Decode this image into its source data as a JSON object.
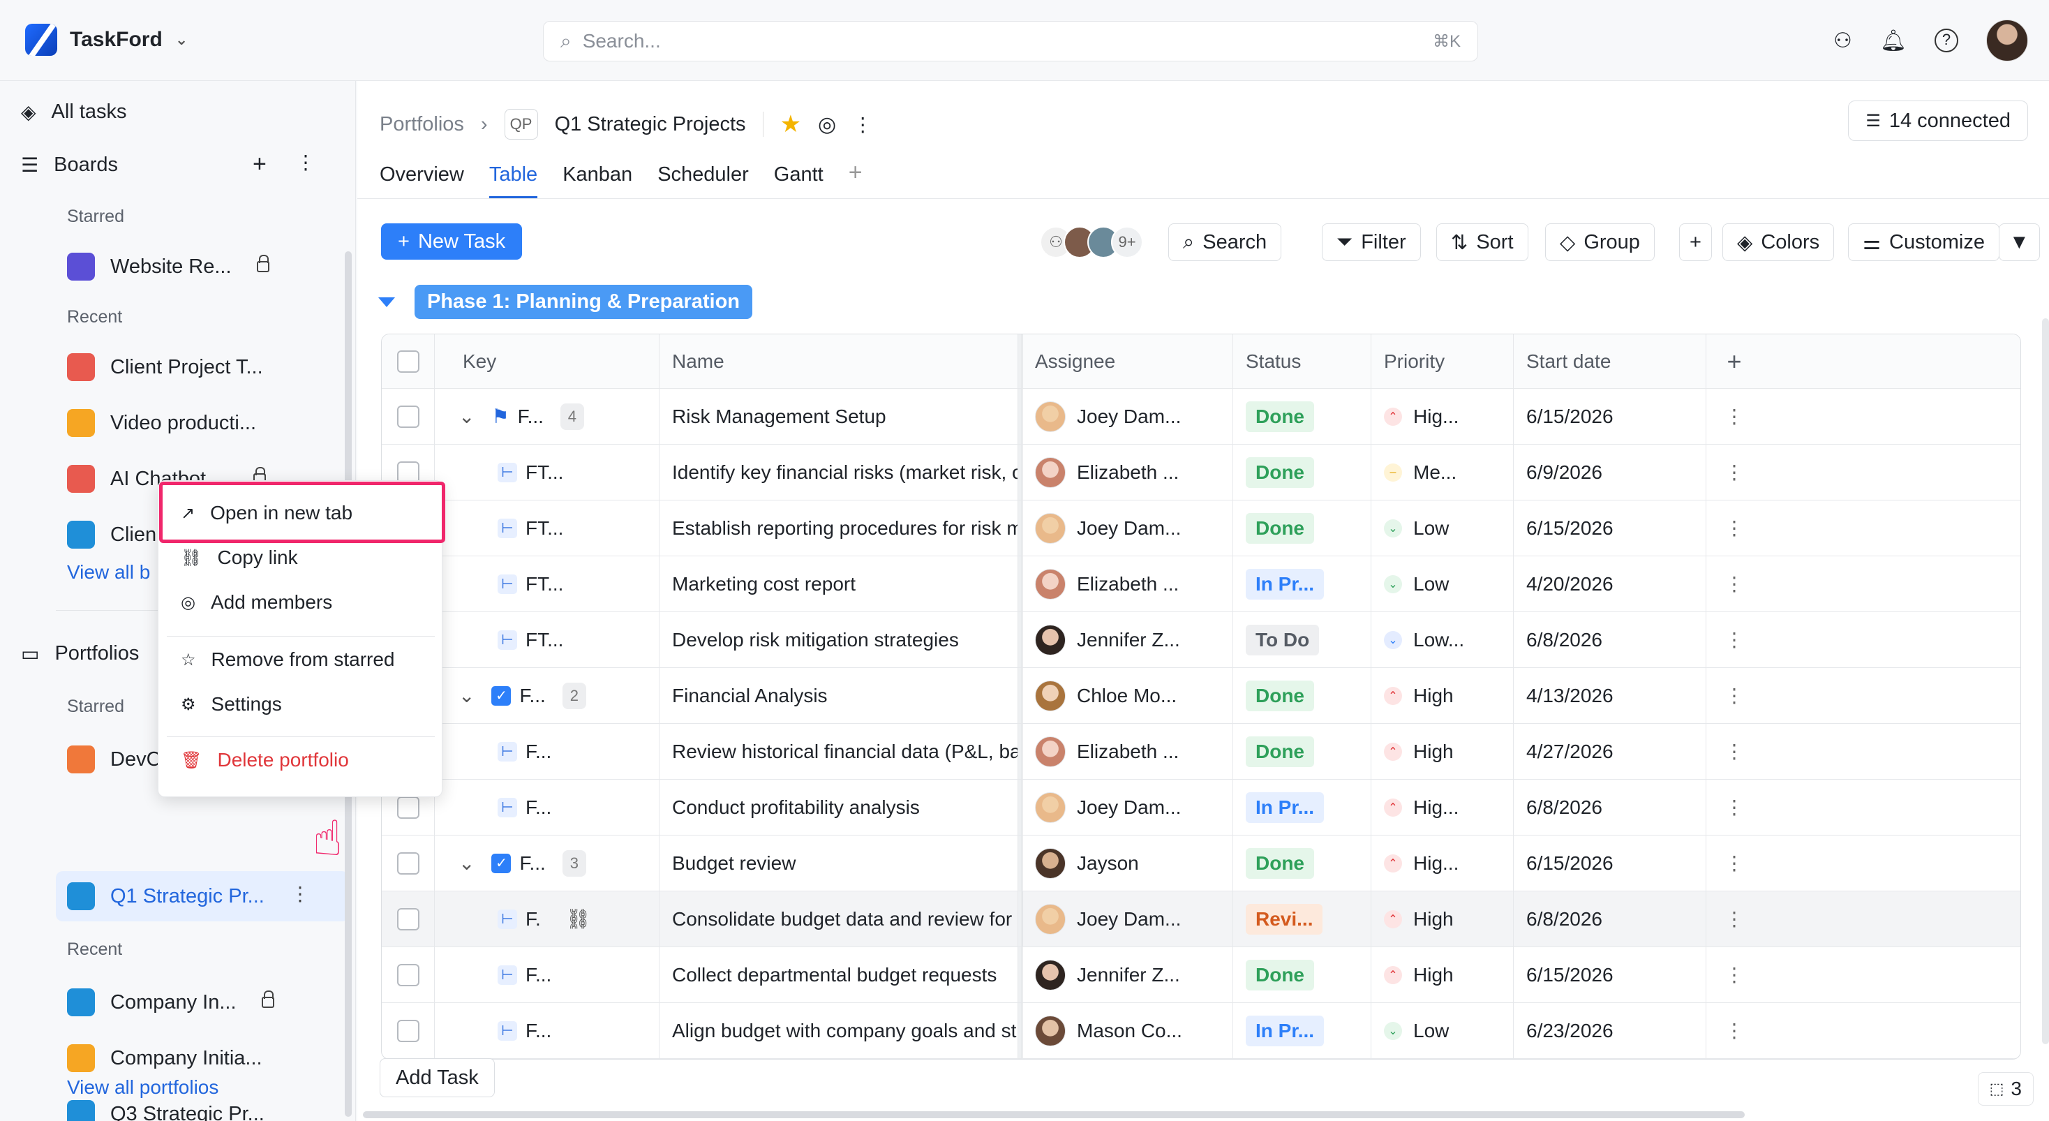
{
  "app": {
    "name": "TaskFord"
  },
  "search": {
    "placeholder": "Search...",
    "shortcut": "⌘K"
  },
  "sidebar": {
    "all_tasks": "All tasks",
    "boards": "Boards",
    "starred_label": "Starred",
    "recent_label": "Recent",
    "boards_starred": [
      {
        "label": "Website Re...",
        "color": "#5b4fd6",
        "locked": true
      }
    ],
    "boards_recent": [
      {
        "label": "Client Project T...",
        "color": "#e85a4f"
      },
      {
        "label": "Video producti...",
        "color": "#f6a623"
      },
      {
        "label": "AI Chatbot ...",
        "color": "#e85a4f"
      },
      {
        "label": "Clien",
        "color": "#1f8fd8"
      }
    ],
    "view_all_boards": "View all b",
    "portfolios": "Portfolios",
    "portfolios_starred": [
      {
        "label": "DevC",
        "color": "#f0783a"
      },
      {
        "label": "Q1 Strategic Pr...",
        "color": "#1f8fd8"
      }
    ],
    "portfolios_recent": [
      {
        "label": "Company In...",
        "color": "#1f8fd8",
        "locked": true
      },
      {
        "label": "Company Initia...",
        "color": "#f6a623"
      },
      {
        "label": "Q3 Strategic Pr...",
        "color": "#1f8fd8"
      }
    ],
    "view_all_portfolios": "View all portfolios"
  },
  "context_menu": {
    "open_new_tab": "Open in new tab",
    "copy_link": "Copy link",
    "add_members": "Add members",
    "remove_starred": "Remove from starred",
    "settings": "Settings",
    "delete": "Delete portfolio"
  },
  "breadcrumb": {
    "root": "Portfolios",
    "badge": "QP",
    "current": "Q1 Strategic Projects"
  },
  "connected": "14 connected",
  "tabs": [
    "Overview",
    "Table",
    "Kanban",
    "Scheduler",
    "Gantt"
  ],
  "toolbar": {
    "new_task": "New Task",
    "avatars_more": "9+",
    "search": "Search",
    "filter": "Filter",
    "sort": "Sort",
    "group": "Group",
    "colors": "Colors",
    "customize": "Customize"
  },
  "group": {
    "title": "Phase 1: Planning & Preparation"
  },
  "table": {
    "headers": {
      "key": "Key",
      "name": "Name",
      "assignee": "Assignee",
      "status": "Status",
      "priority": "Priority",
      "start": "Start date"
    },
    "rows": [
      {
        "key": "F...",
        "type": "flag",
        "count": "4",
        "name": "Risk Management Setup",
        "assignee": "Joey Dam...",
        "status": "Done",
        "priority": "Hig...",
        "start": "6/15/2026"
      },
      {
        "key": "FT...",
        "type": "sub",
        "name": "Identify key financial risks (market risk, operational risk, etc.)",
        "assignee": "Elizabeth ...",
        "status": "Done",
        "priority": "Me...",
        "start": "6/9/2026"
      },
      {
        "key": "FT...",
        "type": "sub",
        "name": "Establish reporting procedures for risk monitoring",
        "assignee": "Joey Dam...",
        "status": "Done",
        "priority": "Low",
        "start": "6/15/2026"
      },
      {
        "key": "FT...",
        "type": "sub",
        "name": "Marketing cost report",
        "assignee": "Elizabeth ...",
        "status": "In Pr...",
        "priority": "Low",
        "start": "4/20/2026"
      },
      {
        "key": "FT...",
        "type": "sub",
        "name": "Develop risk mitigation strategies",
        "assignee": "Jennifer Z...",
        "status": "To Do",
        "priority": "Low...",
        "start": "6/8/2026"
      },
      {
        "key": "F...",
        "type": "check",
        "count": "2",
        "name": "Financial Analysis",
        "assignee": "Chloe Mo...",
        "status": "Done",
        "priority": "High",
        "start": "4/13/2026"
      },
      {
        "key": "F...",
        "type": "sub",
        "name": "Review historical financial data (P&L, balance sheet)",
        "assignee": "Elizabeth ...",
        "status": "Done",
        "priority": "High",
        "start": "4/27/2026"
      },
      {
        "key": "F...",
        "type": "sub",
        "name": "Conduct profitability analysis",
        "assignee": "Joey Dam...",
        "status": "In Pr...",
        "priority": "Hig...",
        "start": "6/8/2026"
      },
      {
        "key": "F...",
        "type": "check",
        "count": "3",
        "name": "Budget review",
        "assignee": "Jayson",
        "status": "Done",
        "priority": "Hig...",
        "start": "6/15/2026"
      },
      {
        "key": "F.",
        "type": "sub",
        "name": "Consolidate budget data and review for accuracy",
        "assignee": "Joey Dam...",
        "status": "Revi...",
        "priority": "High",
        "start": "6/8/2026"
      },
      {
        "key": "F...",
        "type": "sub",
        "name": "Collect departmental budget requests",
        "assignee": "Jennifer Z...",
        "status": "Done",
        "priority": "High",
        "start": "6/15/2026"
      },
      {
        "key": "F...",
        "type": "sub",
        "name": "Align budget with company goals and strategic plans",
        "assignee": "Mason Co...",
        "status": "In Pr...",
        "priority": "Low",
        "start": "6/23/2026"
      }
    ]
  },
  "add_task": "Add Task",
  "footer_count": "3"
}
